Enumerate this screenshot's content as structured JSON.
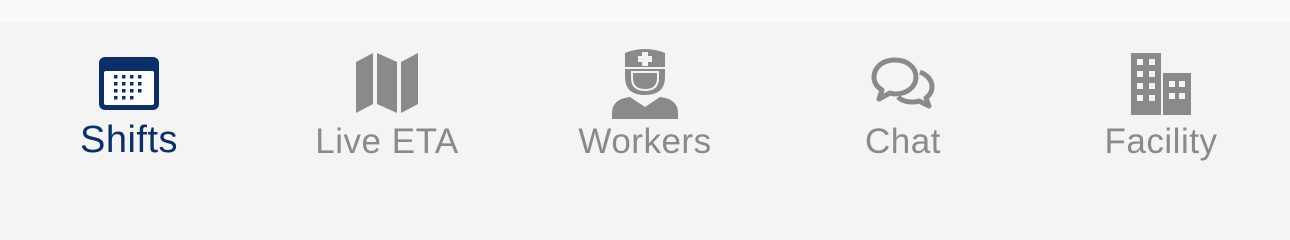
{
  "tab_bar": {
    "active_color": "#0b2f68",
    "inactive_color": "#8a8a8a",
    "tabs": [
      {
        "label": "Shifts",
        "icon": "calendar-icon",
        "active": true
      },
      {
        "label": "Live ETA",
        "icon": "map-icon",
        "active": false
      },
      {
        "label": "Workers",
        "icon": "nurse-icon",
        "active": false
      },
      {
        "label": "Chat",
        "icon": "chat-bubbles-icon",
        "active": false
      },
      {
        "label": "Facility",
        "icon": "building-icon",
        "active": false
      }
    ]
  }
}
